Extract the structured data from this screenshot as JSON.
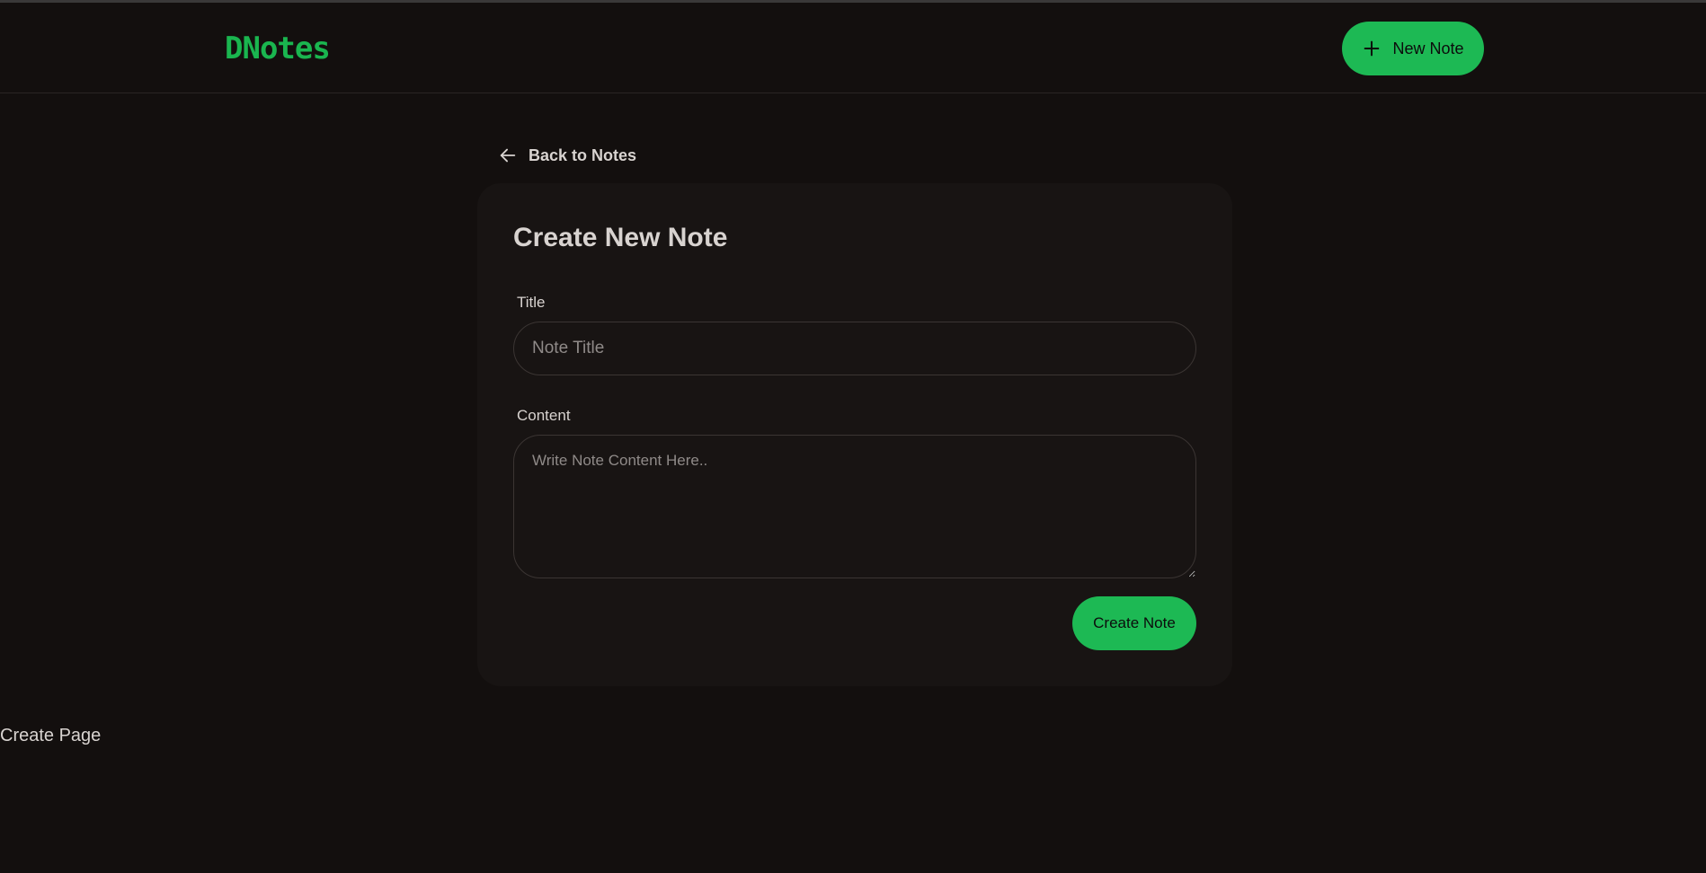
{
  "app": {
    "logo": "DNotes",
    "accent_color": "#1db954"
  },
  "header": {
    "new_note_label": "New Note",
    "new_note_icon": "plus-icon"
  },
  "navigation": {
    "back_label": "Back to Notes",
    "back_icon": "arrow-left-icon"
  },
  "form": {
    "heading": "Create New Note",
    "title_label": "Title",
    "title_placeholder": "Note Title",
    "title_value": "",
    "content_label": "Content",
    "content_placeholder": "Write Note Content Here..",
    "content_value": "",
    "submit_label": "Create Note"
  },
  "footer": {
    "page_label": "Create Page"
  }
}
